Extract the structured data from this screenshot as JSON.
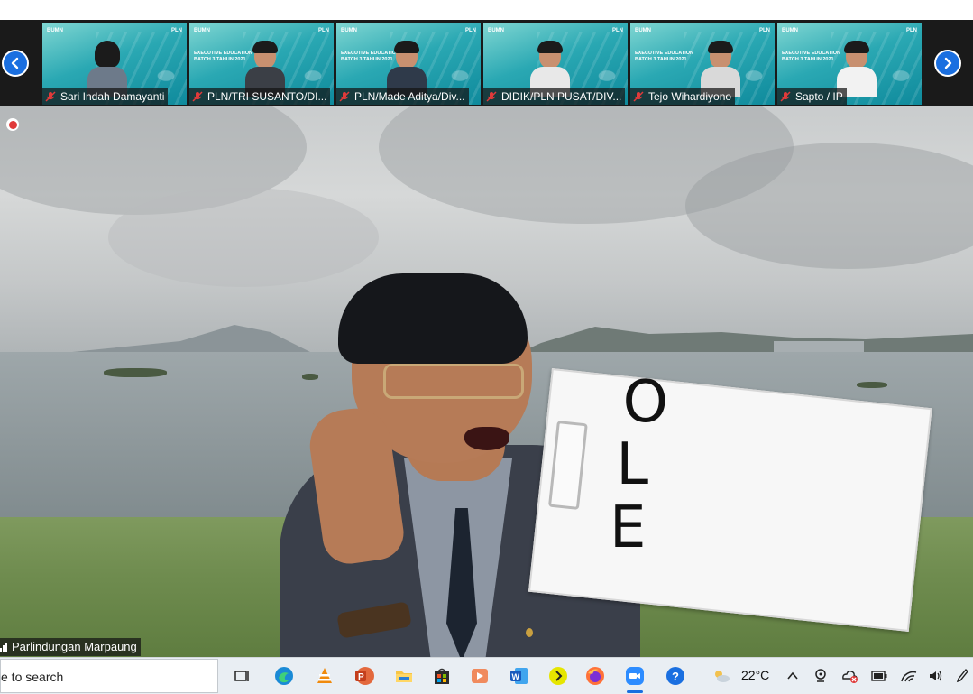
{
  "gallery": {
    "participants": [
      {
        "name": "Sari Indah Damayanti",
        "muted": true
      },
      {
        "name": "PLN/TRI SUSANTO/DI...",
        "muted": true
      },
      {
        "name": "PLN/Made Aditya/Div...",
        "muted": true
      },
      {
        "name": "DIDIK/PLN PUSAT/DIV...",
        "muted": true
      },
      {
        "name": "Tejo Wihardiyono",
        "muted": true
      },
      {
        "name": "Sapto / IP",
        "muted": true
      }
    ],
    "tile_headline": "EXECUTIVE EDUCATION\nBATCH 3 TAHUN 2021",
    "tile_logo_right": "PLN",
    "tile_logo_left": "BUMN"
  },
  "main_video": {
    "speaker_name": "Parlindungan Marpaung",
    "board_letters": [
      "O",
      "L",
      "E"
    ]
  },
  "taskbar": {
    "search_text": "e to search",
    "weather_temp": "22°C",
    "icons": [
      "task-view-icon",
      "edge-icon",
      "vlc-icon",
      "powerpoint-icon",
      "file-explorer-icon",
      "store-icon",
      "media-player-icon",
      "word-icon",
      "arrow-app-icon",
      "firefox-icon",
      "zoom-icon",
      "help-icon"
    ]
  },
  "colors": {
    "accent": "#1a6fe0",
    "name_bar": "#141414",
    "muted_red": "#e03a3a"
  }
}
